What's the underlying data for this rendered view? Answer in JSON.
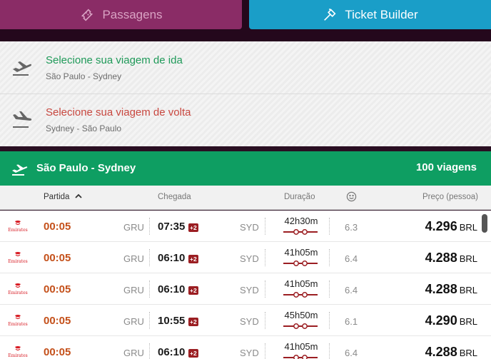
{
  "tabs": [
    {
      "label": "Passagens",
      "icon": "ticket-icon",
      "color": "#8a2c66"
    },
    {
      "label": "Ticket Builder",
      "icon": "hammer-icon",
      "color": "#1a9ec8"
    }
  ],
  "selectors": {
    "ida": {
      "title": "Selecione sua viagem de ida",
      "route": "São Paulo - Sydney",
      "color": "#1f9a59"
    },
    "volta": {
      "title": "Selecione sua viagem de volta",
      "route": "Sydney - São Paulo",
      "color": "#c8473f"
    }
  },
  "results": {
    "route": "São Paulo - Sydney",
    "count": "100 viagens",
    "color": "#0e9e62"
  },
  "columns": {
    "partida": "Partida",
    "chegada": "Chegada",
    "duracao": "Duração",
    "rating_icon": "smiley-icon",
    "preco": "Preço (pessoa)"
  },
  "flights": [
    {
      "airline": "Emirates",
      "dep_time": "00:05",
      "dep_code": "GRU",
      "arr_time": "07:35",
      "plus_days": "+2",
      "arr_code": "SYD",
      "duration": "42h30m",
      "rating": "6.3",
      "price": "4.296",
      "currency": "BRL"
    },
    {
      "airline": "Emirates",
      "dep_time": "00:05",
      "dep_code": "GRU",
      "arr_time": "06:10",
      "plus_days": "+2",
      "arr_code": "SYD",
      "duration": "41h05m",
      "rating": "6.4",
      "price": "4.288",
      "currency": "BRL"
    },
    {
      "airline": "Emirates",
      "dep_time": "00:05",
      "dep_code": "GRU",
      "arr_time": "06:10",
      "plus_days": "+2",
      "arr_code": "SYD",
      "duration": "41h05m",
      "rating": "6.4",
      "price": "4.288",
      "currency": "BRL"
    },
    {
      "airline": "Emirates",
      "dep_time": "00:05",
      "dep_code": "GRU",
      "arr_time": "10:55",
      "plus_days": "+2",
      "arr_code": "SYD",
      "duration": "45h50m",
      "rating": "6.1",
      "price": "4.290",
      "currency": "BRL"
    },
    {
      "airline": "Emirates",
      "dep_time": "00:05",
      "dep_code": "GRU",
      "arr_time": "06:10",
      "plus_days": "+2",
      "arr_code": "SYD",
      "duration": "41h05m",
      "rating": "6.4",
      "price": "4.288",
      "currency": "BRL"
    }
  ]
}
